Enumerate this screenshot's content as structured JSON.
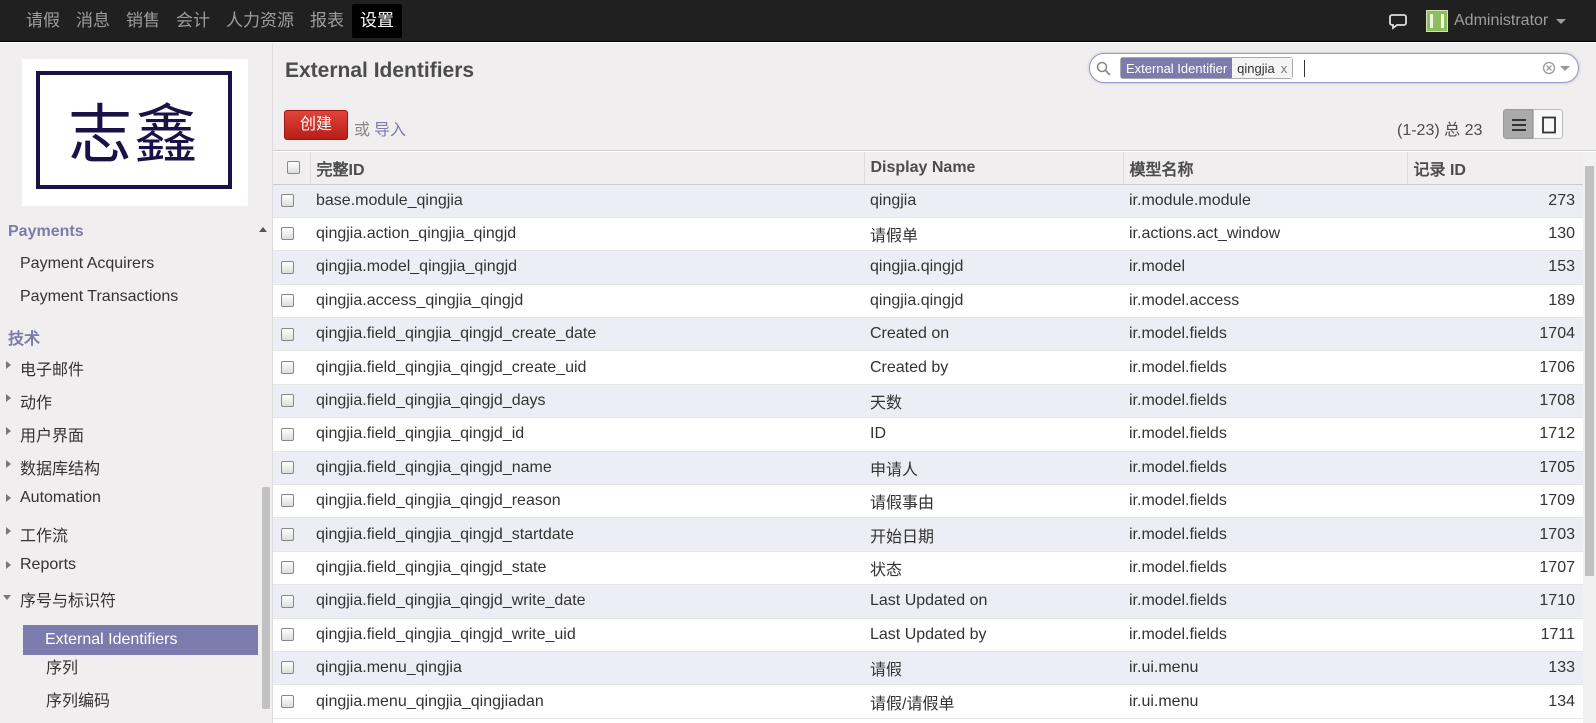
{
  "topnav": {
    "items": [
      "请假",
      "消息",
      "销售",
      "会计",
      "人力资源",
      "报表",
      "设置"
    ],
    "active_index": 6,
    "user_name": "Administrator"
  },
  "sidebar": {
    "logo_text": "志鑫",
    "payments_title": "Payments",
    "payment_acquirers": "Payment Acquirers",
    "payment_transactions": "Payment Transactions",
    "tech_title": "技术",
    "groups": [
      "电子邮件",
      "动作",
      "用户界面",
      "数据库结构",
      "Automation",
      "工作流",
      "Reports"
    ],
    "expanded_group": "序号与标识符",
    "subitems": [
      "External Identifiers",
      "序列",
      "序列编码"
    ]
  },
  "header": {
    "title": "External Identifiers",
    "create_label": "创建",
    "or_text": "或",
    "import_label": "导入",
    "pager": "(1-23) 总 23"
  },
  "search": {
    "facet_category": "External Identifier",
    "facet_value": "qingjia",
    "facet_remove": "x"
  },
  "table": {
    "columns": [
      "完整ID",
      "Display Name",
      "模型名称",
      "记录 ID"
    ],
    "rows": [
      [
        "base.module_qingjia",
        "qingjia",
        "ir.module.module",
        "273"
      ],
      [
        "qingjia.action_qingjia_qingjd",
        "请假单",
        "ir.actions.act_window",
        "130"
      ],
      [
        "qingjia.model_qingjia_qingjd",
        "qingjia.qingjd",
        "ir.model",
        "153"
      ],
      [
        "qingjia.access_qingjia_qingjd",
        "qingjia.qingjd",
        "ir.model.access",
        "189"
      ],
      [
        "qingjia.field_qingjia_qingjd_create_date",
        "Created on",
        "ir.model.fields",
        "1704"
      ],
      [
        "qingjia.field_qingjia_qingjd_create_uid",
        "Created by",
        "ir.model.fields",
        "1706"
      ],
      [
        "qingjia.field_qingjia_qingjd_days",
        "天数",
        "ir.model.fields",
        "1708"
      ],
      [
        "qingjia.field_qingjia_qingjd_id",
        "ID",
        "ir.model.fields",
        "1712"
      ],
      [
        "qingjia.field_qingjia_qingjd_name",
        "申请人",
        "ir.model.fields",
        "1705"
      ],
      [
        "qingjia.field_qingjia_qingjd_reason",
        "请假事由",
        "ir.model.fields",
        "1709"
      ],
      [
        "qingjia.field_qingjia_qingjd_startdate",
        "开始日期",
        "ir.model.fields",
        "1703"
      ],
      [
        "qingjia.field_qingjia_qingjd_state",
        "状态",
        "ir.model.fields",
        "1707"
      ],
      [
        "qingjia.field_qingjia_qingjd_write_date",
        "Last Updated on",
        "ir.model.fields",
        "1710"
      ],
      [
        "qingjia.field_qingjia_qingjd_write_uid",
        "Last Updated by",
        "ir.model.fields",
        "1711"
      ],
      [
        "qingjia.menu_qingjia",
        "请假",
        "ir.ui.menu",
        "133"
      ],
      [
        "qingjia.menu_qingjia_qingjiadan",
        "请假/请假单",
        "ir.ui.menu",
        "134"
      ]
    ]
  }
}
